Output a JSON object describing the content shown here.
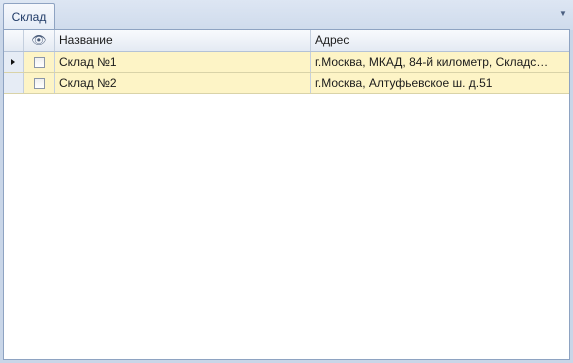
{
  "tab": {
    "label": "Склад"
  },
  "grid": {
    "columns": {
      "name": "Название",
      "address": "Адрес"
    },
    "rows": [
      {
        "name": "Склад №1",
        "address": "г.Москва, МКАД, 84-й километр, Складс…",
        "checked": false,
        "current": true
      },
      {
        "name": "Склад №2",
        "address": "г.Москва, Алтуфьевское ш. д.51",
        "checked": false,
        "current": false
      }
    ]
  }
}
